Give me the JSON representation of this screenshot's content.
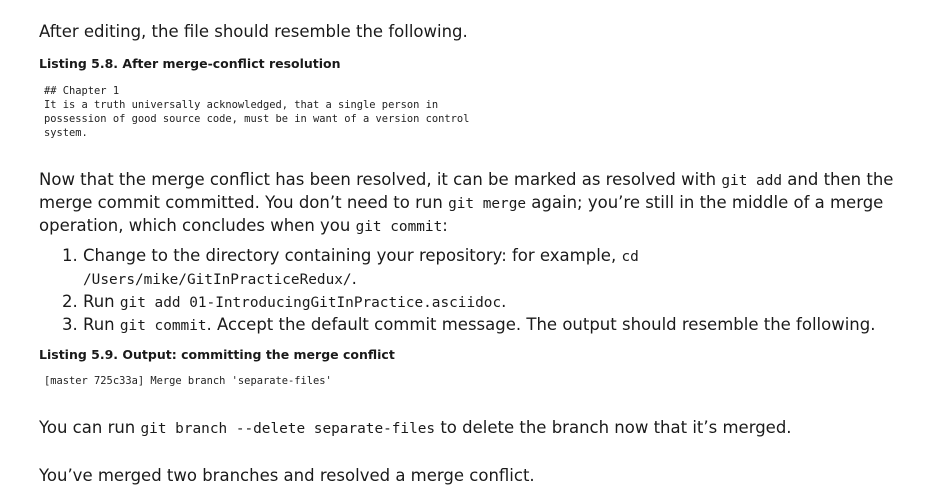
{
  "intro": "After editing, the file should resemble the following.",
  "listing1": {
    "title": "Listing 5.8. After merge-conflict resolution",
    "code": "## Chapter 1\nIt is a truth universally acknowledged, that a single person in\npossession of good source code, must be in want of a version control\nsystem."
  },
  "para2": {
    "l1_a": "Now that the merge conflict has been resolved, it can be marked as resolved with ",
    "l1_code": "git add",
    "l1_b": " and then the",
    "l2_a": "merge commit committed. You don’t need to run ",
    "l2_code": "git merge",
    "l2_b": " again; you’re still in the middle of a merge",
    "l3_a": "operation, which concludes when you ",
    "l3_code": "git commit",
    "l3_b": ":"
  },
  "steps": [
    {
      "a": "Change to the directory containing your repository: for example, ",
      "code1": "cd",
      "code2": "/Users/mike/GitInPracticeRedux/",
      "b": "."
    },
    {
      "a": "Run ",
      "code": "git add 01-IntroducingGitInPractice.asciidoc",
      "b": "."
    },
    {
      "a": "Run ",
      "code": "git commit",
      "b": ". Accept the default commit message. The output should resemble the following."
    }
  ],
  "listing2": {
    "title": "Listing 5.9. Output: committing the merge conflict",
    "code": "[master 725c33a] Merge branch 'separate-files'"
  },
  "para3": {
    "a": "You can run ",
    "code": "git branch --delete separate-files",
    "b": " to delete the branch now that it’s merged."
  },
  "para4": "You’ve merged two branches and resolved a merge conflict."
}
